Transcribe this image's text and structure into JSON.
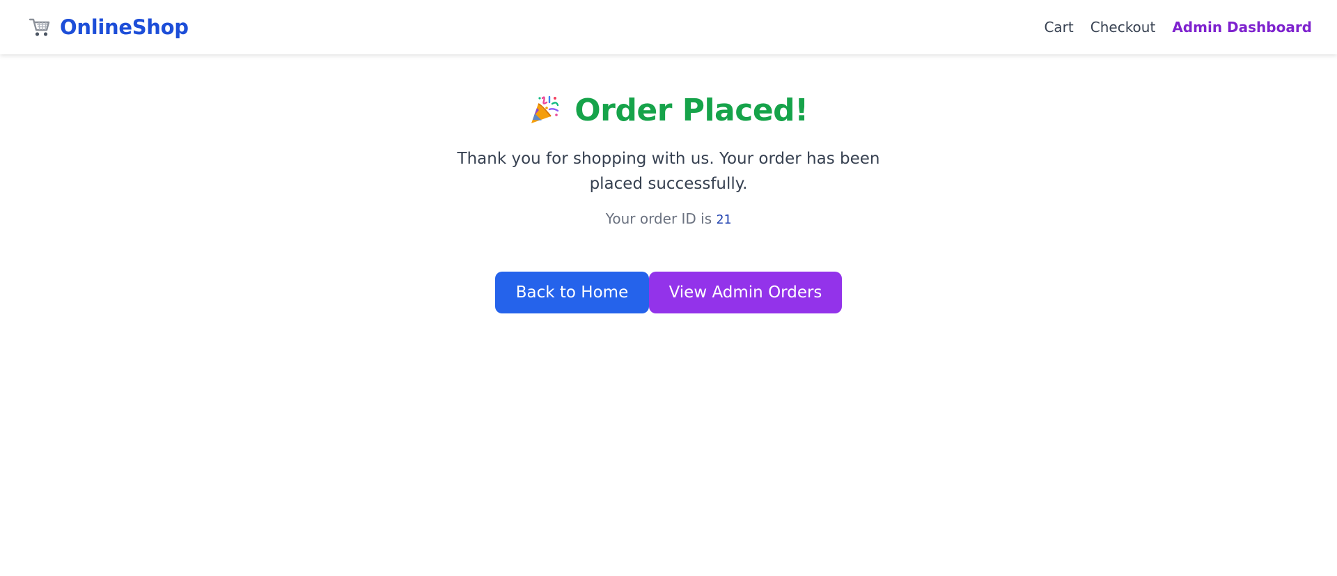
{
  "header": {
    "brand": {
      "icon": "shopping-cart-icon",
      "name": "OnlineShop"
    },
    "nav": {
      "cart": "Cart",
      "checkout": "Checkout",
      "admin_dashboard": "Admin Dashboard"
    }
  },
  "main": {
    "title_icon": "party-popper-icon",
    "title": "Order Placed!",
    "message": "Thank you for shopping with us. Your order has been placed successfully.",
    "order_label": "Your order ID is",
    "order_id": "21",
    "buttons": {
      "back_home": "Back to Home",
      "view_admin_orders": "View Admin Orders"
    }
  },
  "colors": {
    "brand": "#1d4ed8",
    "success": "#16a34a",
    "primary_button": "#2563eb",
    "admin_accent": "#9333ea"
  }
}
